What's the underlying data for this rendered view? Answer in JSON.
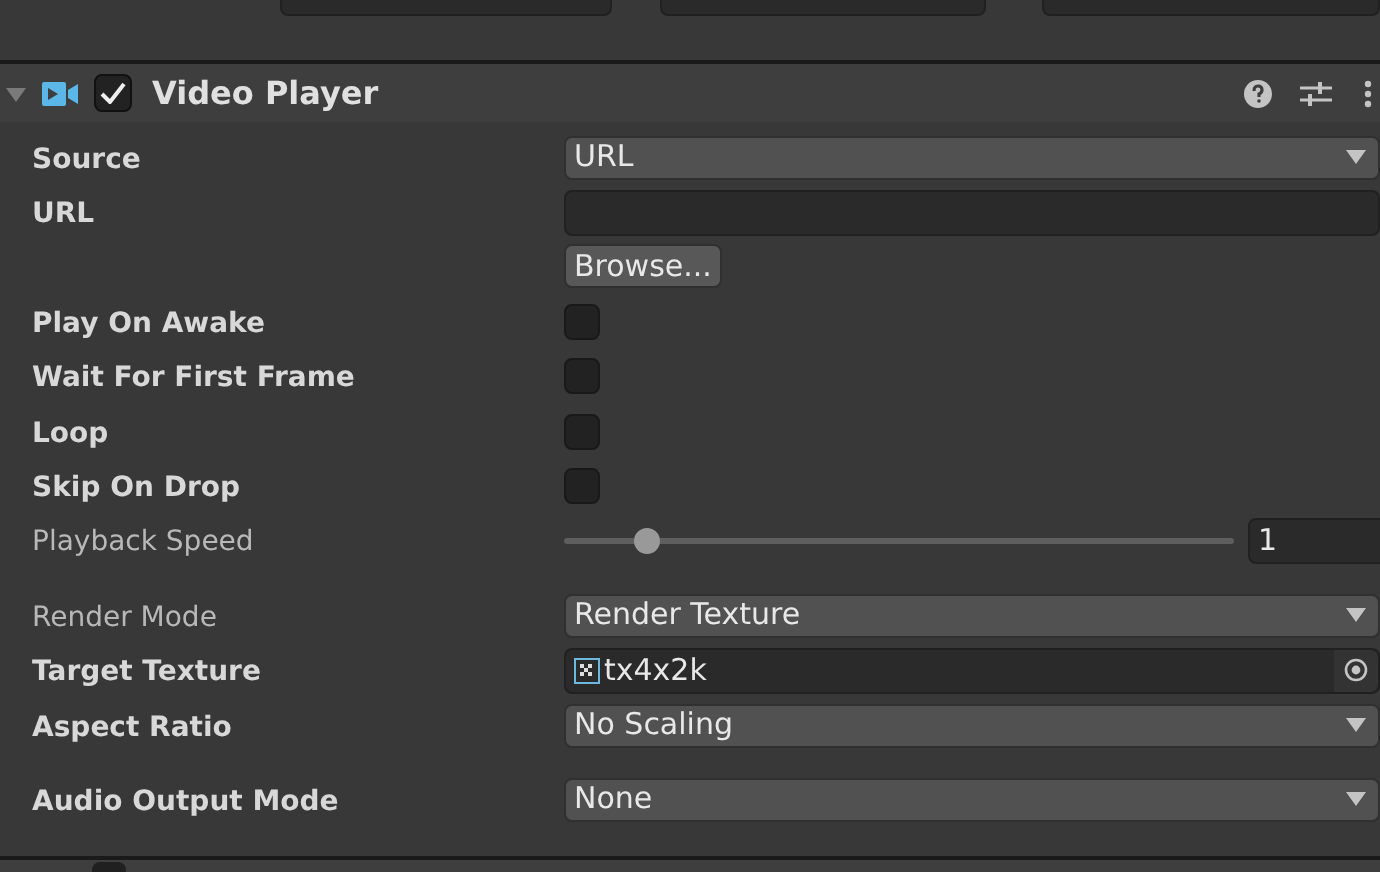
{
  "component": {
    "title": "Video Player",
    "enabled": true,
    "expanded": true
  },
  "rows": [
    {
      "kind": "dropdown",
      "label": "Source",
      "modified": true,
      "value": "URL"
    },
    {
      "kind": "text",
      "label": "URL",
      "modified": true,
      "value": ""
    },
    {
      "kind": "button",
      "value": "Browse..."
    },
    {
      "kind": "checkbox",
      "label": "Play On Awake",
      "modified": true,
      "checked": false
    },
    {
      "kind": "checkbox",
      "label": "Wait For First Frame",
      "modified": true,
      "checked": false
    },
    {
      "kind": "checkbox",
      "label": "Loop",
      "modified": true,
      "checked": false
    },
    {
      "kind": "checkbox",
      "label": "Skip On Drop",
      "modified": true,
      "checked": false
    },
    {
      "kind": "slider",
      "label": "Playback Speed",
      "modified": false,
      "level": 0.11,
      "value": "1"
    },
    {
      "kind": "gap"
    },
    {
      "kind": "dropdown",
      "label": "Render Mode",
      "modified": false,
      "value": "Render Texture"
    },
    {
      "kind": "object",
      "label": "Target Texture",
      "modified": true,
      "value": "tx4x2k"
    },
    {
      "kind": "dropdown",
      "label": "Aspect Ratio",
      "modified": true,
      "value": "No Scaling"
    },
    {
      "kind": "gap"
    },
    {
      "kind": "dropdown",
      "label": "Audio Output Mode",
      "modified": true,
      "value": "None"
    }
  ],
  "next_component": {
    "enabled": false
  }
}
